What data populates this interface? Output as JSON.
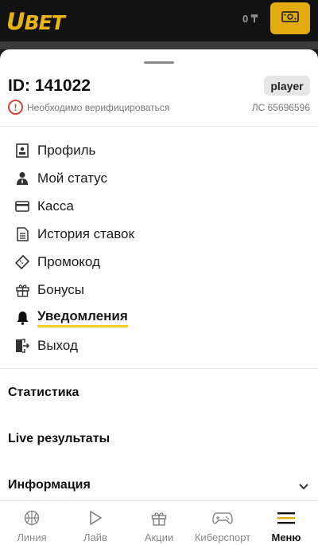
{
  "header": {
    "logo_u": "U",
    "logo_rest": "BET",
    "balance": "0 ₸"
  },
  "profile": {
    "id_label": "ID: 141022",
    "role": "player",
    "verify_text": "Необходимо верифицироваться",
    "account": "ЛС 65696596"
  },
  "menu": [
    {
      "label": "Профиль",
      "icon": "profile-card-icon"
    },
    {
      "label": "Мой статус",
      "icon": "user-status-icon"
    },
    {
      "label": "Касса",
      "icon": "credit-card-icon"
    },
    {
      "label": "История ставок",
      "icon": "document-icon"
    },
    {
      "label": "Промокод",
      "icon": "ticket-icon"
    },
    {
      "label": "Бонусы",
      "icon": "gift-icon"
    },
    {
      "label": "Уведомления",
      "icon": "bell-icon",
      "active": true
    },
    {
      "label": "Выход",
      "icon": "logout-icon"
    }
  ],
  "sections": {
    "stats": "Статистика",
    "live_results": "Live результаты",
    "info": "Информация"
  },
  "bottom_nav": [
    {
      "label": "Линия",
      "icon": "basketball-icon"
    },
    {
      "label": "Лайв",
      "icon": "play-icon"
    },
    {
      "label": "Акции",
      "icon": "gift-icon"
    },
    {
      "label": "Киберспорт",
      "icon": "gamepad-icon"
    },
    {
      "label": "Меню",
      "icon": "menu-icon",
      "active": true
    }
  ],
  "colors": {
    "accent": "#e2ac11",
    "underline": "#f2cf1f",
    "warning": "#d9453b"
  }
}
